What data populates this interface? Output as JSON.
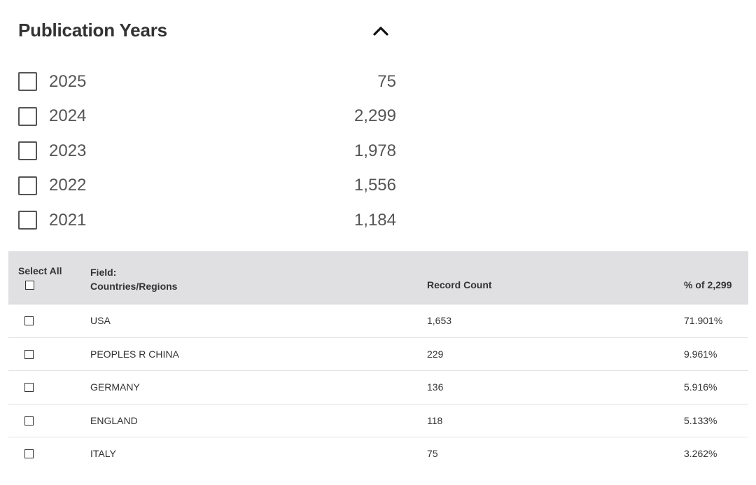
{
  "facet": {
    "title": "Publication Years",
    "collapse_icon": "chevron-up-icon",
    "items": [
      {
        "label": "2025",
        "count": "75",
        "checked": false
      },
      {
        "label": "2024",
        "count": "2,299",
        "checked": false
      },
      {
        "label": "2023",
        "count": "1,978",
        "checked": false
      },
      {
        "label": "2022",
        "count": "1,556",
        "checked": false
      },
      {
        "label": "2021",
        "count": "1,184",
        "checked": false
      }
    ]
  },
  "table": {
    "select_all_label": "Select All",
    "field_label": "Field:",
    "field_name": "Countries/Regions",
    "count_header": "Record Count",
    "percent_header": "% of 2,299",
    "header_background": "#e0e0e2",
    "rows": [
      {
        "name": "USA",
        "count": "1,653",
        "percent": "71.901%"
      },
      {
        "name": "PEOPLES R CHINA",
        "count": "229",
        "percent": "9.961%"
      },
      {
        "name": "GERMANY",
        "count": "136",
        "percent": "5.916%"
      },
      {
        "name": "ENGLAND",
        "count": "118",
        "percent": "5.133%"
      },
      {
        "name": "ITALY",
        "count": "75",
        "percent": "3.262%"
      }
    ]
  }
}
